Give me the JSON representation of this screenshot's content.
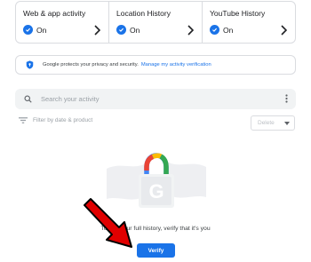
{
  "controls": [
    {
      "title": "Web & app activity",
      "status": "On"
    },
    {
      "title": "Location History",
      "status": "On"
    },
    {
      "title": "YouTube History",
      "status": "On"
    }
  ],
  "notice": {
    "text": "Google protects your privacy and security.",
    "link": "Manage my activity verification"
  },
  "search": {
    "placeholder": "Search your activity"
  },
  "filter": {
    "label": "Filter by date & product"
  },
  "delete": {
    "label": "Delete"
  },
  "verify": {
    "message": "To see your full history, verify that it's you",
    "button": "Verify"
  },
  "colors": {
    "accent": "#1a73e8",
    "arrow": "#e00000"
  }
}
